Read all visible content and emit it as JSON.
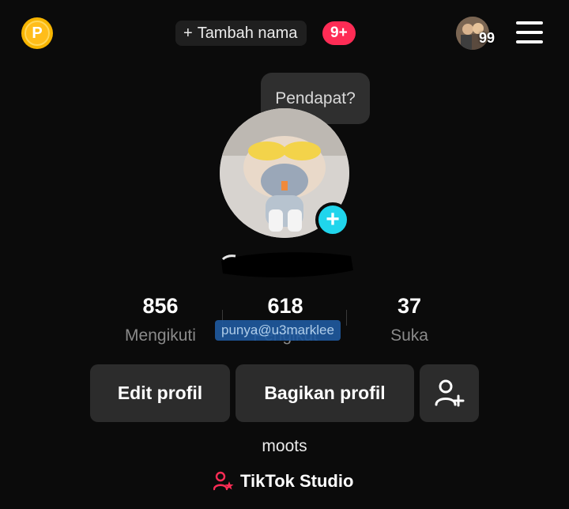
{
  "header": {
    "coin_letter": "P",
    "add_name_plus": "+",
    "add_name_label": "Tambah nama",
    "notification_badge": "9+",
    "friends_count": "99"
  },
  "profile": {
    "bubble_text": "Pendapat?",
    "add_avatar_symbol": "+",
    "watermark": "punya@u3marklee",
    "bio": "moots"
  },
  "stats": {
    "following_count": "856",
    "following_label": "Mengikuti",
    "followers_count": "618",
    "followers_label": "Pengikut",
    "likes_count": "37",
    "likes_label": "Suka"
  },
  "actions": {
    "edit_profile": "Edit profil",
    "share_profile": "Bagikan profil"
  },
  "footer": {
    "studio_label": "TikTok Studio"
  },
  "colors": {
    "background": "#0b0b0b",
    "button": "#2c2c2c",
    "accent_red": "#fe2c55",
    "accent_cyan": "#20d5ec",
    "coin": "#f7b500"
  }
}
